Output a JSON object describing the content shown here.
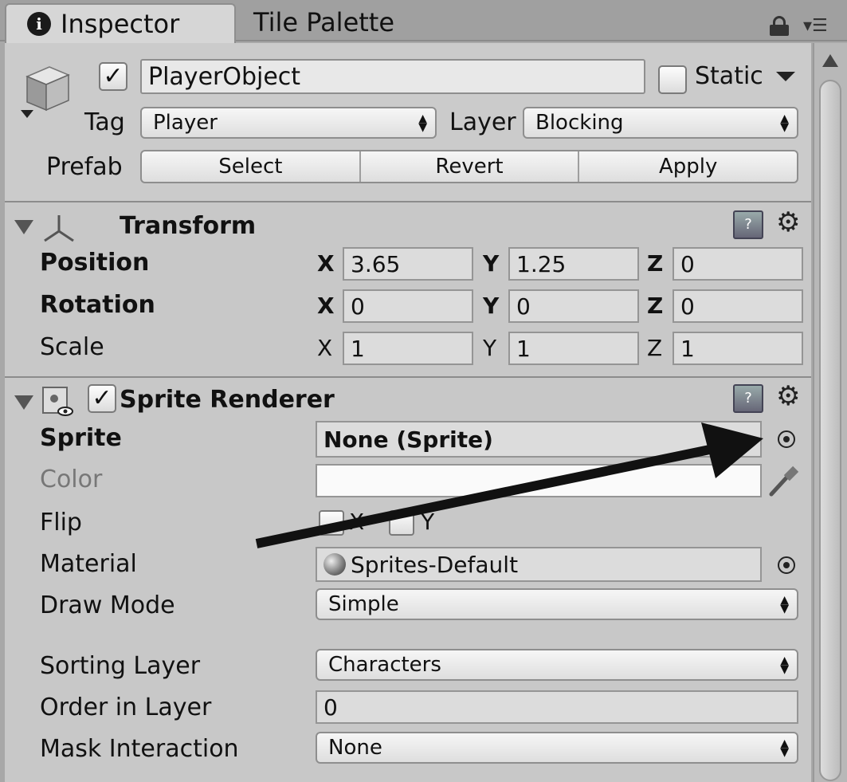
{
  "tabs": {
    "inspector": "Inspector",
    "tile_palette": "Tile Palette"
  },
  "header": {
    "object_name": "PlayerObject",
    "active_checked": true,
    "static_label": "Static",
    "static_checked": false,
    "tag_label": "Tag",
    "tag_value": "Player",
    "layer_label": "Layer",
    "layer_value": "Blocking",
    "prefab_label": "Prefab",
    "prefab_select": "Select",
    "prefab_revert": "Revert",
    "prefab_apply": "Apply"
  },
  "transform": {
    "title": "Transform",
    "rows": [
      {
        "label": "Position",
        "x": "3.65",
        "y": "1.25",
        "z": "0"
      },
      {
        "label": "Rotation",
        "x": "0",
        "y": "0",
        "z": "0"
      },
      {
        "label": "Scale",
        "x": "1",
        "y": "1",
        "z": "1"
      }
    ],
    "axis_x": "X",
    "axis_y": "Y",
    "axis_z": "Z"
  },
  "sprite_renderer": {
    "title": "Sprite Renderer",
    "enabled": true,
    "sprite_label": "Sprite",
    "sprite_value": "None (Sprite)",
    "color_label": "Color",
    "flip_label": "Flip",
    "flip_x": "X",
    "flip_y": "Y",
    "material_label": "Material",
    "material_value": "Sprites-Default",
    "draw_mode_label": "Draw Mode",
    "draw_mode_value": "Simple",
    "sorting_layer_label": "Sorting Layer",
    "sorting_layer_value": "Characters",
    "order_label": "Order in Layer",
    "order_value": "0",
    "mask_label": "Mask Interaction",
    "mask_value": "None"
  },
  "icons": {
    "info": "info-icon",
    "lock": "lock-icon",
    "menu": "menu-icon",
    "cube": "cube-icon",
    "transform": "transform-axes-icon",
    "sprite": "sprite-renderer-icon",
    "help": "help-book-icon",
    "gear": "gear-icon",
    "target": "object-picker-icon",
    "eyedropper": "eyedropper-icon"
  },
  "colors": {
    "annotation_arrow": "#111111"
  }
}
